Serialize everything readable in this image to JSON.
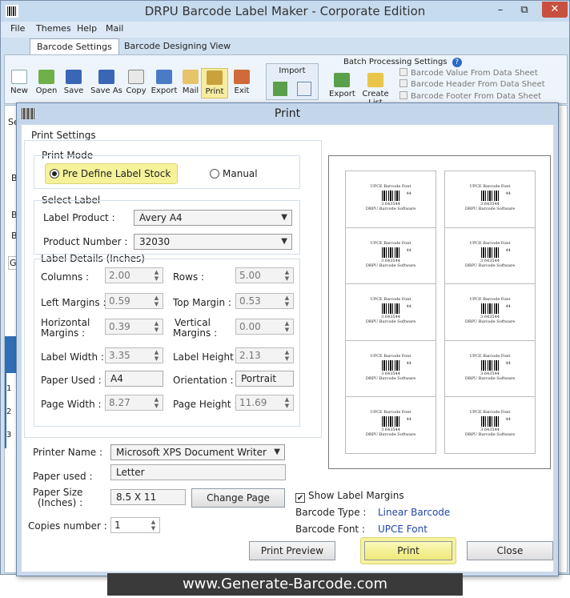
{
  "app": {
    "title": "DRPU Barcode Label Maker - Corporate Edition",
    "window_controls": {
      "minimize": "–",
      "maximize": "⧉",
      "close": "✕"
    }
  },
  "menu": [
    "File",
    "Themes",
    "Help",
    "Mail"
  ],
  "ribbon_tabs": [
    "Barcode Settings",
    "Barcode Designing View"
  ],
  "toolbar": [
    "New",
    "Open",
    "Save",
    "Save As",
    "Copy",
    "Export",
    "Mail",
    "Print",
    "Exit"
  ],
  "import_group": {
    "title": "Import"
  },
  "batch": {
    "title": "Batch Processing Settings",
    "export_label": "Export",
    "create_list_label": "Create List",
    "options": [
      "Barcode Value From Data Sheet",
      "Barcode Header From Data Sheet",
      "Barcode Footer From Data Sheet"
    ]
  },
  "background_fragments": {
    "sel": "Sel",
    "ba1": "Ba",
    "ba2": "Ba",
    "ba3": "Ba",
    "ge": "Ge",
    "ruler": [
      "1",
      "2",
      "3"
    ]
  },
  "dialog": {
    "title": "Print",
    "print_settings": "Print Settings",
    "print_mode": {
      "title": "Print Mode",
      "option_predefined": "Pre Define Label Stock",
      "option_manual": "Manual"
    },
    "select_label": {
      "title": "Select Label",
      "label_product_label": "Label Product :",
      "label_product_value": "Avery A4",
      "product_number_label": "Product Number :",
      "product_number_value": "32030"
    },
    "label_details": {
      "title": "Label Details (Inches)",
      "columns_label": "Columns :",
      "columns_value": "2.00",
      "rows_label": "Rows :",
      "rows_value": "5.00",
      "left_margins_label": "Left Margins :",
      "left_margins_value": "0.59",
      "top_margin_label": "Top Margin :",
      "top_margin_value": "0.53",
      "horizontal_margins_label_1": "Horizontal",
      "horizontal_margins_label_2": "Margins :",
      "horizontal_margins_value": "0.39",
      "vertical_margins_label_1": "Vertical",
      "vertical_margins_label_2": "Margins :",
      "vertical_margins_value": "0.00",
      "label_width_label": "Label Width :",
      "label_width_value": "3.35",
      "label_height_label": "Label Height :",
      "label_height_value": "2.13",
      "paper_used_label": "Paper Used :",
      "paper_used_value": "A4",
      "orientation_label": "Orientation :",
      "orientation_value": "Portrait",
      "page_width_label": "Page Width :",
      "page_width_value": "8.27",
      "page_height_label": "Page Height :",
      "page_height_value": "11.69"
    },
    "printer": {
      "printer_name_label": "Printer Name :",
      "printer_name_value": "Microsoft XPS Document Writer",
      "paper_used_label": "Paper used :",
      "paper_used_value": "Letter",
      "paper_size_label_1": "Paper Size",
      "paper_size_label_2": "(Inches) :",
      "paper_size_value": "8.5 X 11",
      "change_page_button": "Change Page",
      "copies_label": "Copies number :",
      "copies_value": "1"
    },
    "preview": {
      "show_label_margins": "Show Label Margins",
      "barcode_type_label": "Barcode Type :",
      "barcode_type_value": "Linear Barcode",
      "barcode_font_label": "Barcode Font :",
      "barcode_font_value": "UPCE Font",
      "label_header": "UPCE Barcode Font",
      "label_code_left": "3",
      "label_code_mid": "643544",
      "label_code_right": "44",
      "label_footer": "DRPU Barcode Software"
    },
    "buttons": {
      "print_preview": "Print Preview",
      "print": "Print",
      "close": "Close"
    }
  },
  "footer": {
    "banner": "www.Generate-Barcode.com"
  },
  "colors": {
    "accent_highlight": "#f6f29a",
    "link_blue": "#2046a8",
    "title_bar": "#c7dbee"
  }
}
